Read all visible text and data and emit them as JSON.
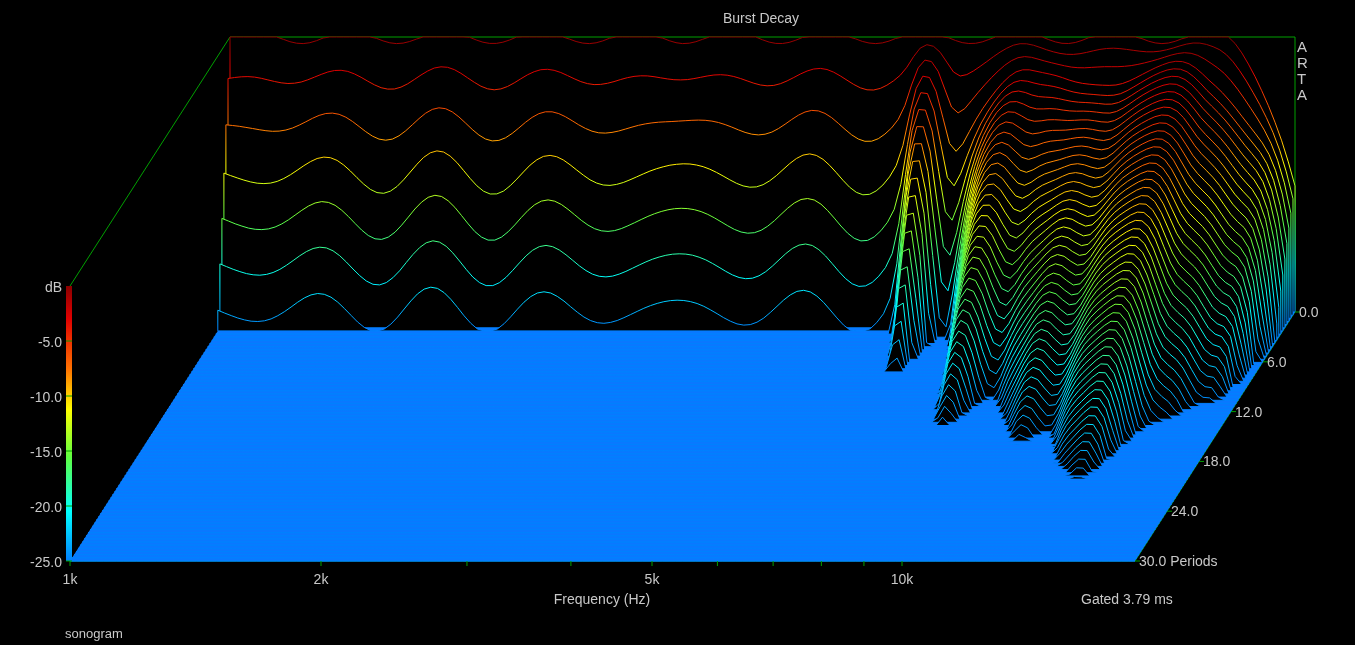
{
  "title": "Burst Decay",
  "brand": "ARTA",
  "color_scale": {
    "unit": "dB",
    "ticks": [
      "-5.0",
      "-10.0",
      "-15.0",
      "-20.0",
      "-25.0"
    ]
  },
  "x_axis": {
    "label": "Frequency (Hz)",
    "ticks": [
      "1k",
      "2k",
      "5k",
      "10k"
    ]
  },
  "z_axis": {
    "ticks": [
      "0.0",
      "6.0",
      "12.0",
      "18.0",
      "24.0",
      "30.0 Periods"
    ]
  },
  "gate_note": "Gated 3.79 ms",
  "footer": "sonogram"
}
